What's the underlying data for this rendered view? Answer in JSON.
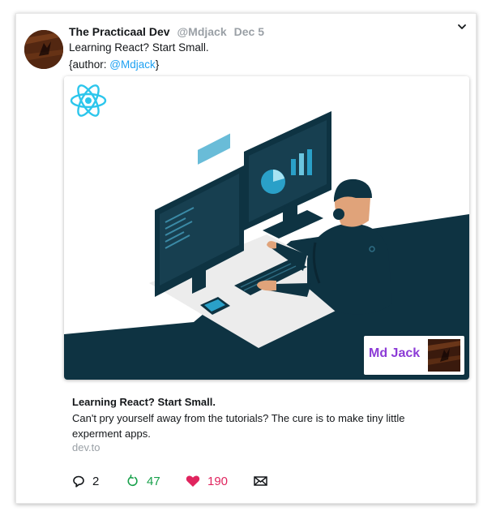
{
  "tweet": {
    "author_name": "The Practicaal Dev",
    "author_handle": "@Mdjack",
    "date": "Dec 5",
    "text_line1": "Learning React? Start Small.",
    "text_line2_prefix": "{author: ",
    "text_line2_mention": "@Mdjack",
    "text_line2_suffix": "}"
  },
  "card": {
    "badge_name": "Md Jack",
    "link_title": "Learning React? Start Small.",
    "link_description": "Can't pry yourself away from the tutorials? The cure is to make tiny little experment apps.",
    "link_domain": "dev.to"
  },
  "actions": {
    "replies": "2",
    "retweets": "47",
    "likes": "190"
  },
  "icons": [
    "chevron-down-icon",
    "react-logo-icon",
    "reply-icon",
    "retweet-icon",
    "heart-icon",
    "mail-icon"
  ],
  "colors": {
    "mention": "#1da1f2",
    "retweet": "#17a04a",
    "like": "#e0245e",
    "badge_name": "#8c3bd6",
    "illustration_dark": "#0e3342",
    "react_logo": "#2cc6ec"
  }
}
